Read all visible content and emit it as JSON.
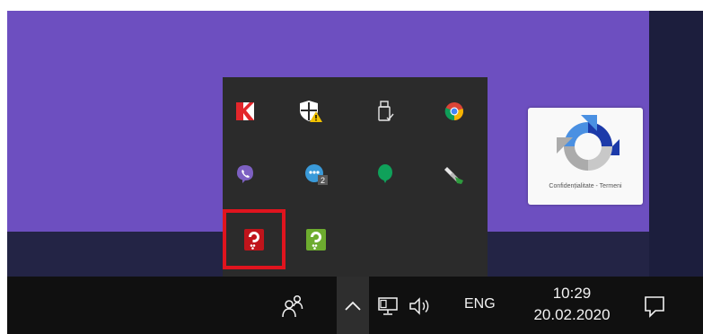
{
  "taskbar": {
    "language": "ENG",
    "time": "10:29",
    "date": "20.02.2020"
  },
  "recaptcha": {
    "links_text": "Confidențialitate - Termeni"
  },
  "tray_icons": [
    {
      "name": "kaspersky-icon"
    },
    {
      "name": "windows-security-warning-icon"
    },
    {
      "name": "usb-drive-icon"
    },
    {
      "name": "chrome-icon"
    },
    {
      "name": "viber-icon"
    },
    {
      "name": "chat-badge-2-icon"
    },
    {
      "name": "green-balloon-icon"
    },
    {
      "name": "usb-eject-icon"
    },
    {
      "name": "red-security-key-icon"
    },
    {
      "name": "green-security-key-icon"
    }
  ],
  "colors": {
    "desktop": "#6d4fc0",
    "taskbar": "#101010",
    "flyout": "#2b2b2b",
    "highlight": "#e0141e"
  }
}
